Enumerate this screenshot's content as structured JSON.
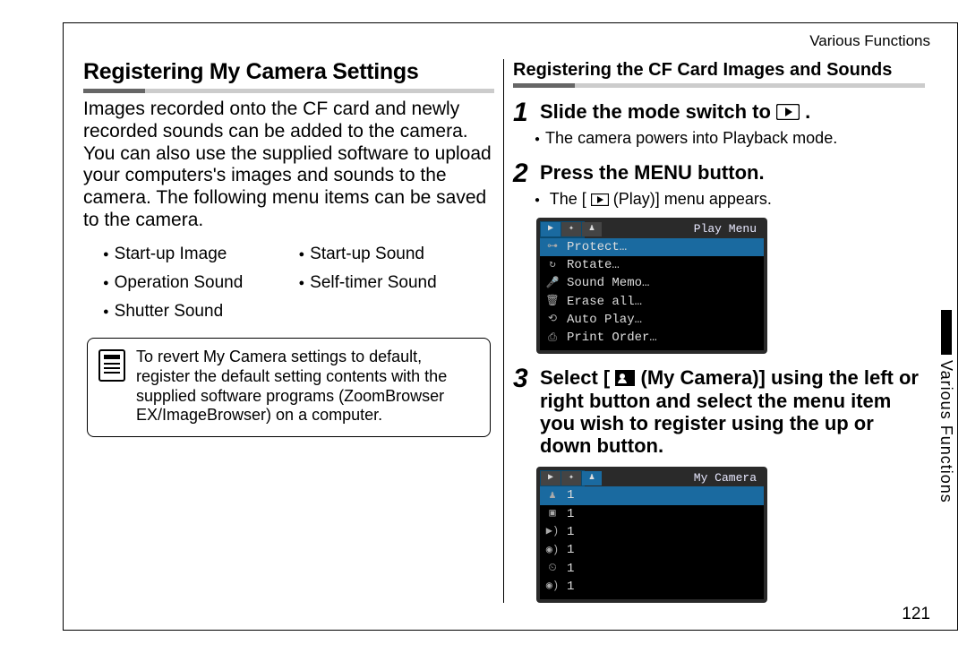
{
  "headerRight": "Various Functions",
  "sideLabel": "Various Functions",
  "pageNumber": "121",
  "left": {
    "title": "Registering My Camera Settings",
    "intro": "Images recorded onto the CF card and newly recorded sounds can be added to the camera. You can also use the supplied software to upload your computers's images and sounds to the camera. The following menu items can be saved to the camera.",
    "items": {
      "a": "Start-up Image",
      "b": "Start-up Sound",
      "c": "Operation Sound",
      "d": "Self-timer Sound",
      "e": "Shutter Sound"
    },
    "note": "To revert My Camera settings to default, register the default setting contents with the supplied software programs (ZoomBrowser EX/ImageBrowser) on a computer."
  },
  "right": {
    "title": "Registering the CF Card Images and Sounds",
    "steps": {
      "s1": {
        "num": "1",
        "title_a": "Slide the mode switch to ",
        "title_b": ".",
        "bullet": "The camera powers into Playback mode."
      },
      "s2": {
        "num": "2",
        "title": "Press the MENU button.",
        "bullet_a": "The [",
        "bullet_b": " (Play)] menu appears."
      },
      "s3": {
        "num": "3",
        "title_a": "Select [",
        "title_b": " (My Camera)] using the left or right button and select the menu item you wish to register using the up or down button."
      }
    },
    "lcd1": {
      "title": "Play Menu",
      "rows": {
        "r1": "Protect…",
        "r2": "Rotate…",
        "r3": "Sound Memo…",
        "r4": "Erase all…",
        "r5": "Auto Play…",
        "r6": "Print Order…"
      }
    },
    "lcd2": {
      "title": "My Camera",
      "valcol": "1"
    }
  }
}
